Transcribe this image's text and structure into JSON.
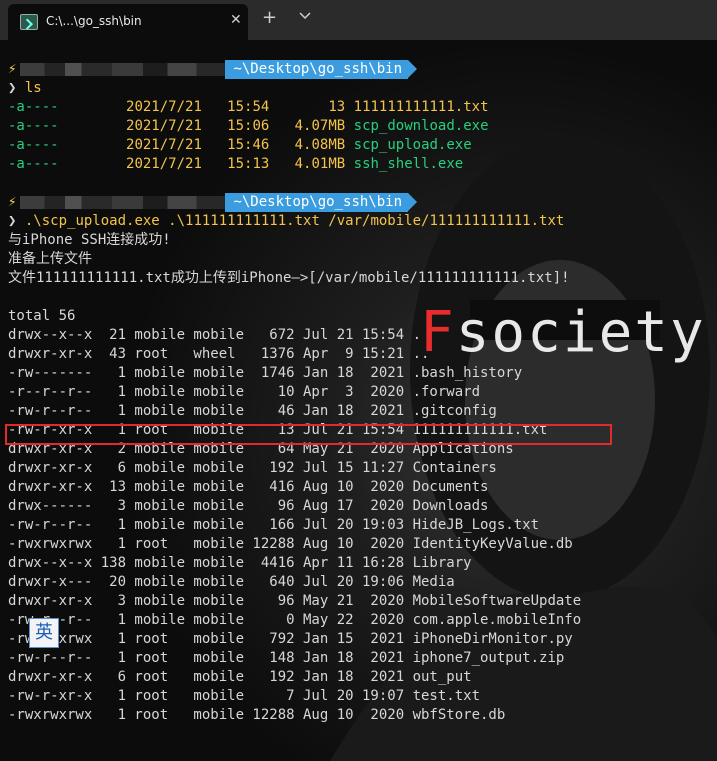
{
  "window": {
    "tab_title": "C:\\...\\go_ssh\\bin",
    "close_symbol": "✕",
    "new_tab_symbol": "+"
  },
  "prompt": {
    "bolt": "⚡",
    "path": "~\\Desktop\\go_ssh\\bin",
    "arrow": "❯"
  },
  "commands": {
    "ls": "ls",
    "upload": ".\\scp_upload.exe .\\111111111111.txt /var/mobile/111111111111.txt"
  },
  "ls_output": [
    {
      "mode": "-a----",
      "date": "2021/7/21",
      "time": "15:54",
      "size": "13",
      "name": "111111111111.txt",
      "color": "yellow"
    },
    {
      "mode": "-a----",
      "date": "2021/7/21",
      "time": "15:06",
      "size": "4.07MB",
      "name": "scp_download.exe",
      "color": "green"
    },
    {
      "mode": "-a----",
      "date": "2021/7/21",
      "time": "15:46",
      "size": "4.08MB",
      "name": "scp_upload.exe",
      "color": "green"
    },
    {
      "mode": "-a----",
      "date": "2021/7/21",
      "time": "15:13",
      "size": "4.01MB",
      "name": "ssh_shell.exe",
      "color": "green"
    }
  ],
  "upload_output": [
    "与iPhone SSH连接成功!",
    "准备上传文件",
    "文件111111111111.txt成功上传到iPhone—>[/var/mobile/111111111111.txt]!"
  ],
  "listing_total": "total 56",
  "listing": [
    "drwx--x--x  21 mobile mobile   672 Jul 21 15:54 .",
    "drwxr-xr-x  43 root   wheel   1376 Apr  9 15:21 ..",
    "-rw-------   1 mobile mobile  1746 Jan 18  2021 .bash_history",
    "-r--r--r--   1 mobile mobile    10 Apr  3  2020 .forward",
    "-rw-r--r--   1 mobile mobile    46 Jan 18  2021 .gitconfig",
    "-rw-r-xr-x   1 root   mobile    13 Jul 21 15:54 111111111111.txt",
    "drwxr-xr-x   2 mobile mobile    64 May 21  2020 Applications",
    "drwxr-xr-x   6 mobile mobile   192 Jul 15 11:27 Containers",
    "drwxr-xr-x  13 mobile mobile   416 Aug 10  2020 Documents",
    "drwx------   3 mobile mobile    96 Aug 17  2020 Downloads",
    "-rw-r--r--   1 mobile mobile   166 Jul 20 19:03 HideJB_Logs.txt",
    "-rwxrwxrwx   1 root   mobile 12288 Aug 10  2020 IdentityKeyValue.db",
    "drwx--x--x 138 mobile mobile  4416 Apr 11 16:28 Library",
    "drwxr-x---  20 mobile mobile   640 Jul 20 19:06 Media",
    "drwxr-xr-x   3 mobile mobile    96 May 21  2020 MobileSoftwareUpdate",
    "-rw-r--r--   1 mobile mobile     0 May 22  2020 com.apple.mobileInfo",
    "-rwxrwxrwx   1 root   mobile   792 Jan 15  2021 iPhoneDirMonitor.py",
    "-rw-r--r--   1 root   mobile   148 Jan 18  2021 iphone7_output.zip",
    "drwxr-xr-x   6 root   mobile   192 Jan 18  2021 out_put",
    "-rw-r-xr-x   1 root   mobile     7 Jul 20 19:07 test.txt",
    "-rwxrwxrwx   1 root   mobile 12288 Aug 10  2020 wbfStore.db"
  ],
  "ime_indicator": "英",
  "background_text": {
    "f": "F",
    "rest": "society"
  },
  "colors": {
    "segment": "#3b9de0",
    "highlight_box": "#e12a2a",
    "exe_green": "#27d07c",
    "txt_yellow": "#f4c44a"
  }
}
